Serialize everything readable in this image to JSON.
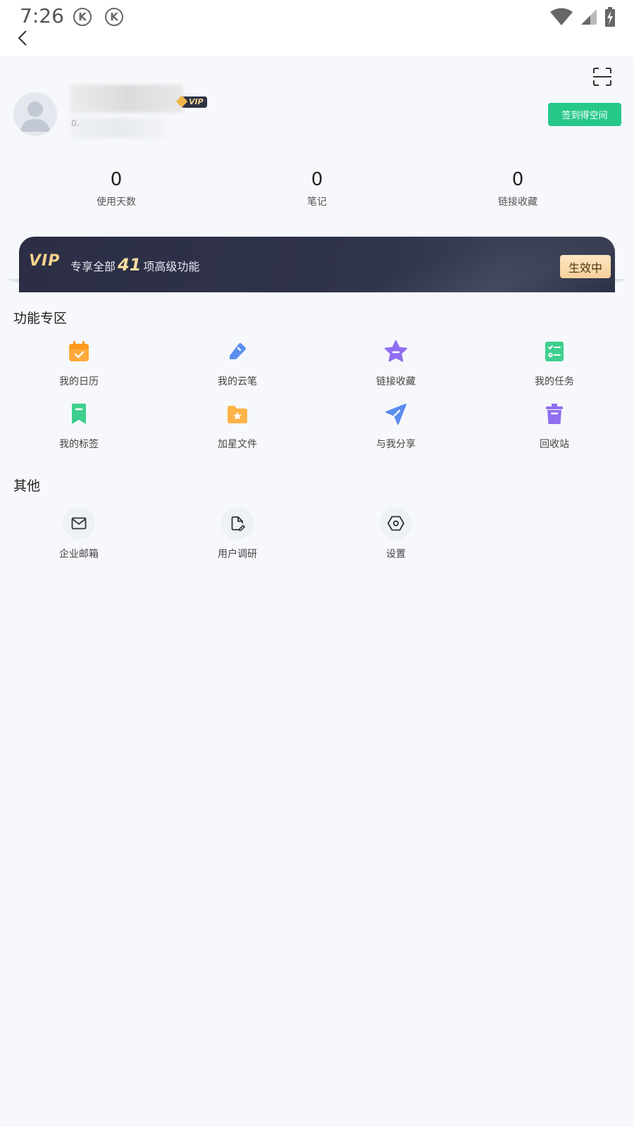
{
  "status_bar": {
    "time": "7:26",
    "notification_icons": [
      "K",
      "K"
    ]
  },
  "profile": {
    "id_prefix": "0.",
    "vip_badge": "VIP",
    "signin_button": "签到得空间"
  },
  "stats": [
    {
      "value": "0",
      "label": "使用天数"
    },
    {
      "value": "0",
      "label": "笔记"
    },
    {
      "value": "0",
      "label": "链接收藏"
    }
  ],
  "vip_banner": {
    "logo": "VIP",
    "text_before": "专享全部",
    "count": "41",
    "text_after": "项高级功能",
    "status": "生效中"
  },
  "features": {
    "title": "功能专区",
    "items": [
      {
        "label": "我的日历",
        "icon": "calendar-icon",
        "color": "#ffa93a"
      },
      {
        "label": "我的云笔",
        "icon": "pen-icon",
        "color": "#5b8def"
      },
      {
        "label": "链接收藏",
        "icon": "star-icon",
        "color": "#8f6ef0"
      },
      {
        "label": "我的任务",
        "icon": "task-list-icon",
        "color": "#3ecf8e"
      },
      {
        "label": "我的标签",
        "icon": "bookmark-icon",
        "color": "#3ecf8e"
      },
      {
        "label": "加星文件",
        "icon": "starred-folder-icon",
        "color": "#ffb347"
      },
      {
        "label": "与我分享",
        "icon": "send-icon",
        "color": "#5b8def"
      },
      {
        "label": "回收站",
        "icon": "trash-icon",
        "color": "#8f6ef0"
      }
    ]
  },
  "others": {
    "title": "其他",
    "items": [
      {
        "label": "企业邮箱",
        "icon": "mail-icon"
      },
      {
        "label": "用户调研",
        "icon": "survey-doc-icon"
      },
      {
        "label": "设置",
        "icon": "settings-hex-icon"
      }
    ]
  }
}
